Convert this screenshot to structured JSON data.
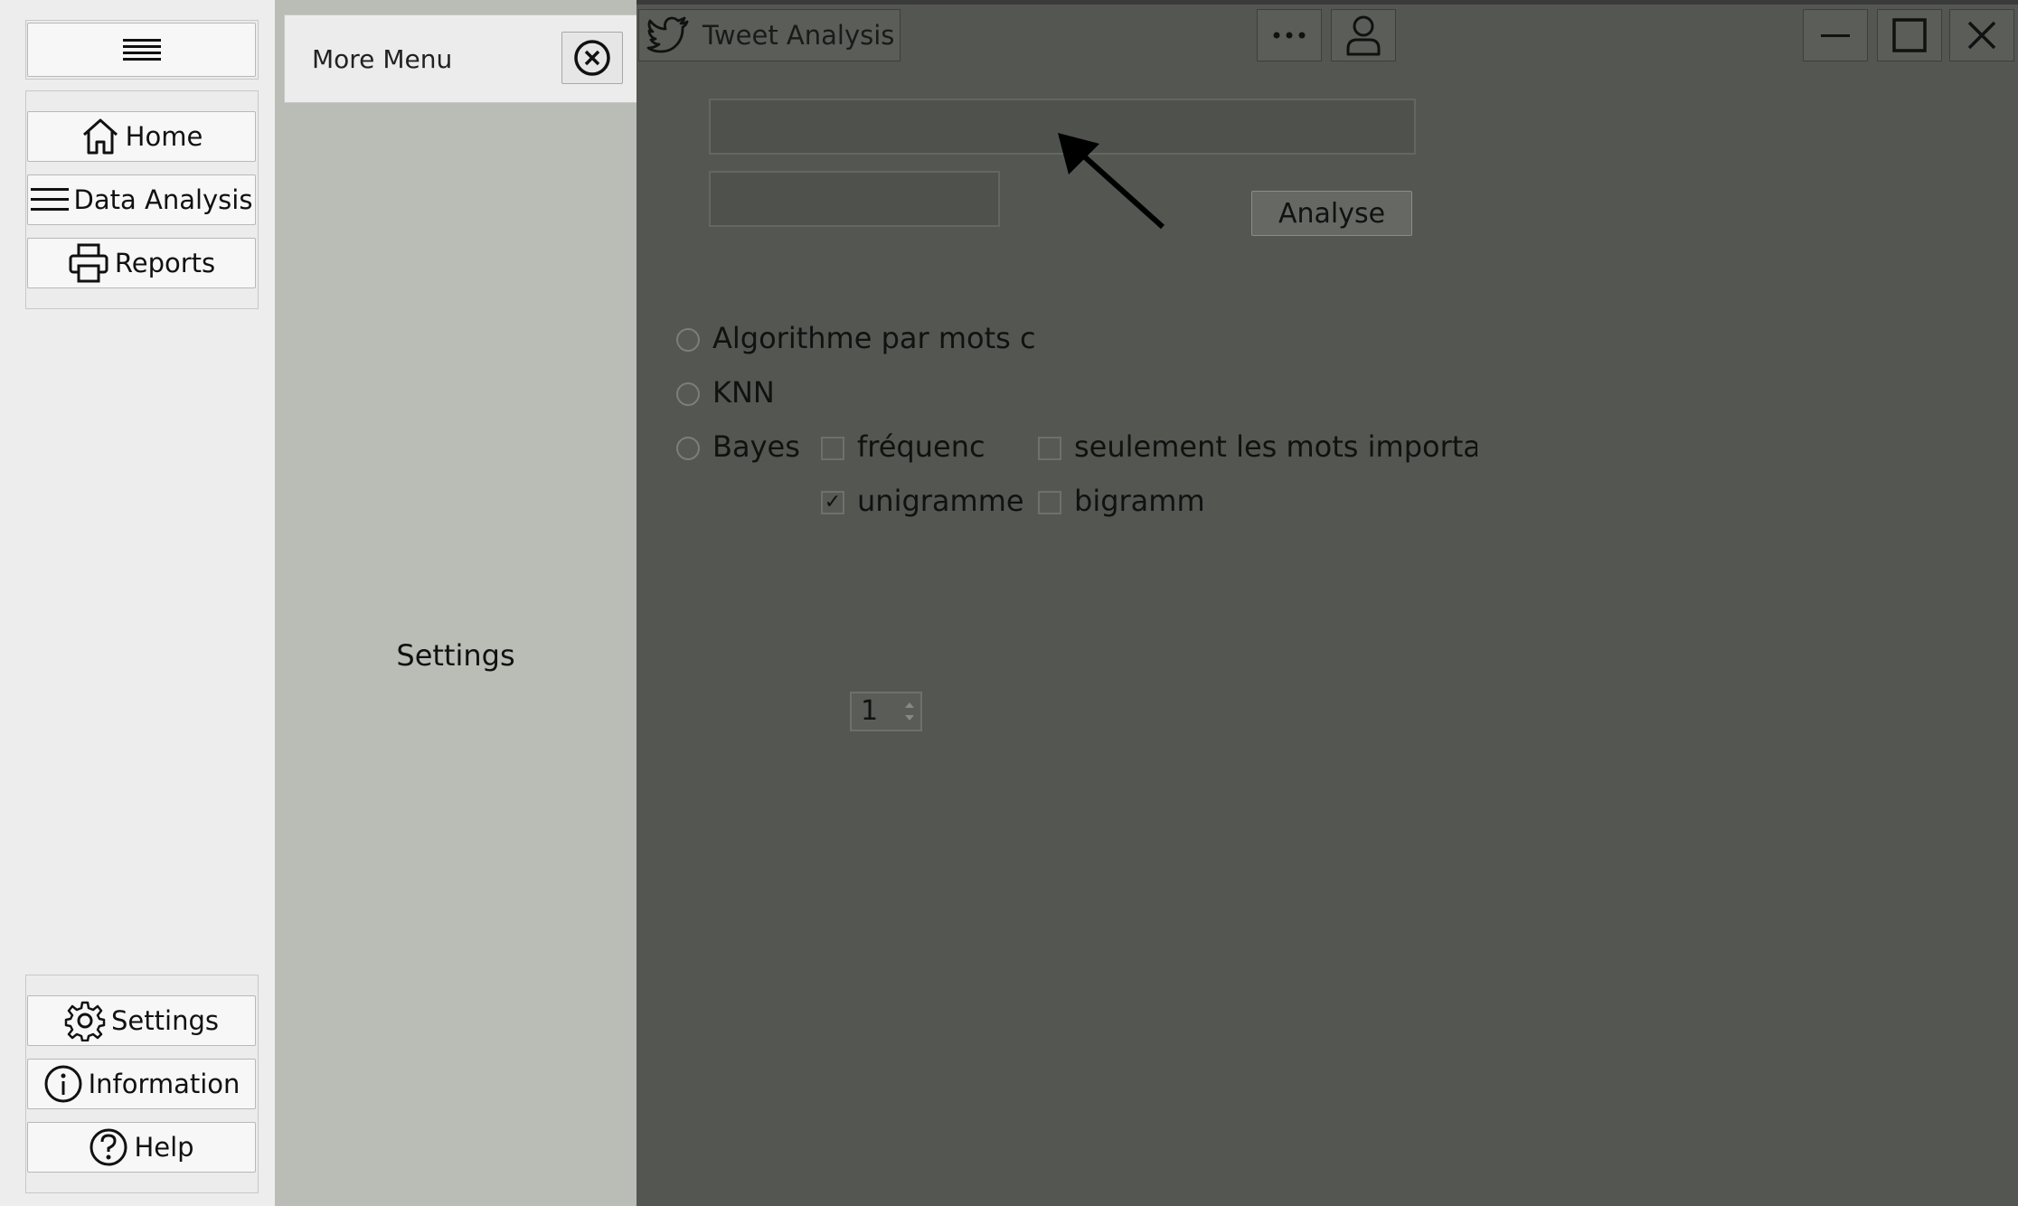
{
  "sidebar": {
    "items_top": [
      {
        "label": "Home",
        "icon": "home-icon"
      },
      {
        "label": "Data Analysis",
        "icon": "list-icon"
      },
      {
        "label": "Reports",
        "icon": "printer-icon"
      }
    ],
    "items_bottom": [
      {
        "label": "Settings",
        "icon": "gear-icon"
      },
      {
        "label": "Information",
        "icon": "info-icon"
      },
      {
        "label": "Help",
        "icon": "help-icon"
      }
    ]
  },
  "more_menu": {
    "title": "More Menu",
    "content": "Settings"
  },
  "window": {
    "title": "Tweet Analysis",
    "input1_value": "",
    "input2_value": "",
    "analyse_label": "Analyse"
  },
  "options": {
    "radio_keyword": "Algorithme par mots c",
    "radio_knn": "KNN",
    "knn_value": "1",
    "radio_bayes": "Bayes",
    "check_frequency": "fréquenc",
    "check_important": "seulement les mots importar",
    "check_unigram": "unigramme",
    "check_bigram": "bigramme",
    "check_unigram_checked": true,
    "check_bigram_checked": false,
    "check_frequency_checked": false,
    "check_important_checked": false
  },
  "colors": {
    "main_bg": "#545651",
    "panel_bg": "#babdb6",
    "sidebar_bg": "#ededed"
  }
}
